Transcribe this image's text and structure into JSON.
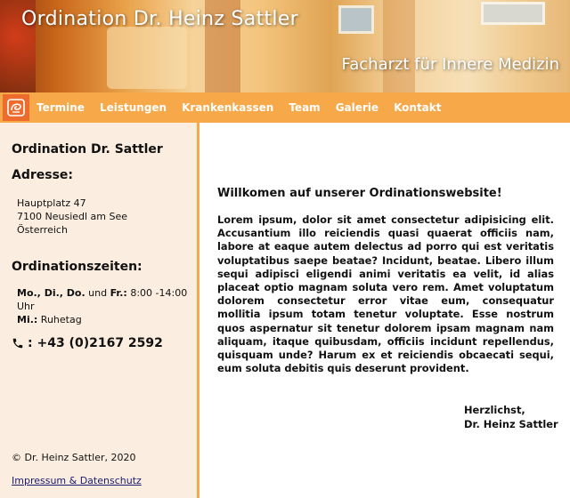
{
  "header": {
    "title": "Ordination Dr. Heinz Sattler",
    "subtitle": "Facharzt für Innere Medizin"
  },
  "nav": {
    "logo_icon": "practice-logo-icon",
    "items": [
      "Termine",
      "Leistungen",
      "Krankenkassen",
      "Team",
      "Galerie",
      "Kontakt"
    ]
  },
  "sidebar": {
    "title": "Ordination Dr. Sattler",
    "address_heading": "Adresse:",
    "address_lines": [
      "Hauptplatz 47",
      "7100 Neusiedl am See",
      "Österreich"
    ],
    "hours_heading": "Ordinationszeiten:",
    "hours": [
      {
        "days_1": "Mo., Di., Do.",
        "joiner_1": " und ",
        "days_2": "Fr.:",
        "time": " 8:00 -14:00 Uhr"
      },
      {
        "days_1": "Mi.:",
        "rest": " Ruhetag"
      }
    ],
    "phone_icon": "phone-icon",
    "phone": ": +43 (0)2167 2592",
    "copyright": "© Dr. Heinz Sattler, 2020",
    "impressum_link": "Impressum & Datenschutz"
  },
  "main": {
    "heading": "Willkomen auf unserer Ordinationswebsite!",
    "body": "Lorem ipsum, dolor sit amet consectetur adipisicing elit. Accusantium illo reiciendis quasi quaerat officiis nam, labore at eaque autem delectus ad porro qui est veritatis voluptatibus saepe beatae? Incidunt, beatae. Libero illum sequi adipisci eligendi animi veritatis ea velit, id alias placeat optio magnam soluta vero rem. Amet voluptatum dolorem consectetur error vitae eum, consequatur mollitia ipsum totam tenetur voluptate. Esse nostrum quos aspernatur sit tenetur dolorem ipsam magnam nam aliquam, itaque quibusdam, officiis incidunt repellendus, quisquam unde? Harum ex et reiciendis obcaecati sequi, eum soluta debitis quis deserunt provident.",
    "closing": "Herzlichst,",
    "signature": "Dr. Heinz Sattler"
  },
  "colors": {
    "nav_bg": "#f7a848",
    "sidebar_bg": "#fbeee0",
    "logo_bg": "#ee6b2e",
    "link": "#1a1a6e"
  }
}
